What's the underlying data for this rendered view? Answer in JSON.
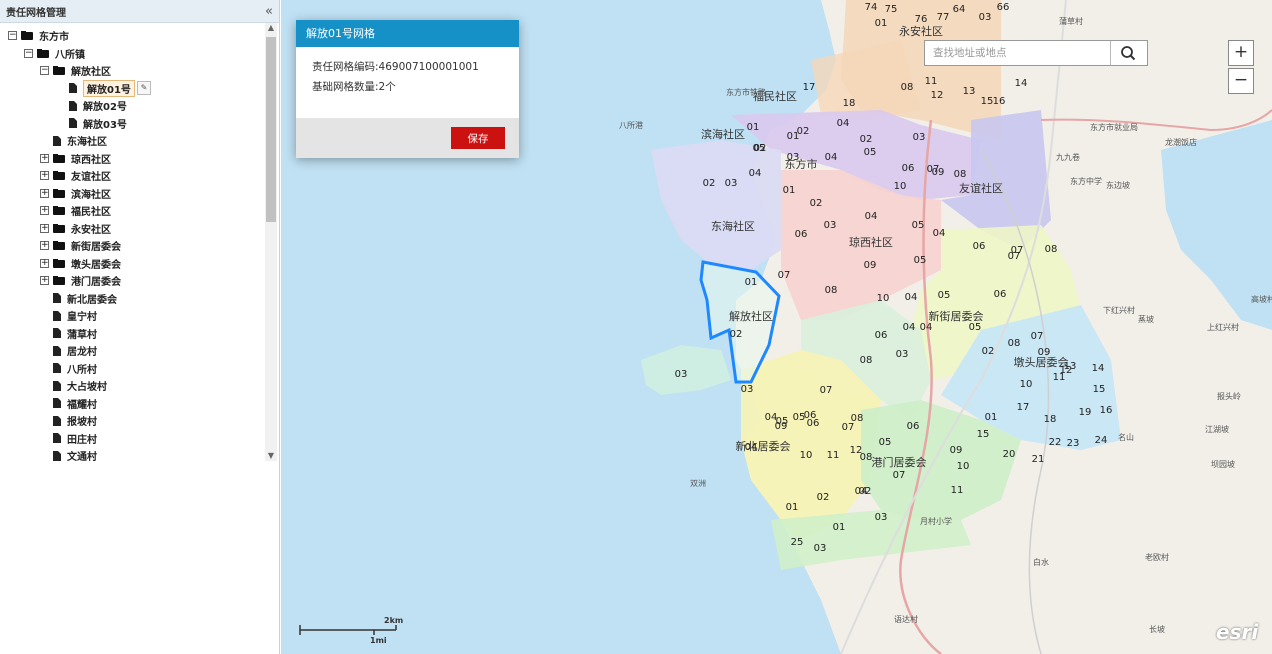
{
  "panel": {
    "title": "责任网格管理",
    "collapse_glyph": "«"
  },
  "tree": [
    {
      "level": 0,
      "toggle": "−",
      "type": "folder",
      "label": "东方市"
    },
    {
      "level": 1,
      "toggle": "−",
      "type": "folder",
      "label": "八所镇"
    },
    {
      "level": 2,
      "toggle": "−",
      "type": "folder",
      "label": "解放社区"
    },
    {
      "level": 3,
      "toggle": "",
      "type": "doc",
      "label": "解放01号",
      "selected": true
    },
    {
      "level": 3,
      "toggle": "",
      "type": "doc",
      "label": "解放02号"
    },
    {
      "level": 3,
      "toggle": "",
      "type": "doc",
      "label": "解放03号"
    },
    {
      "level": 2,
      "toggle": "",
      "type": "doc",
      "label": "东海社区"
    },
    {
      "level": 2,
      "toggle": "+",
      "type": "folder",
      "label": "琼西社区"
    },
    {
      "level": 2,
      "toggle": "+",
      "type": "folder",
      "label": "友谊社区"
    },
    {
      "level": 2,
      "toggle": "+",
      "type": "folder",
      "label": "滨海社区"
    },
    {
      "level": 2,
      "toggle": "+",
      "type": "folder",
      "label": "福民社区"
    },
    {
      "level": 2,
      "toggle": "+",
      "type": "folder",
      "label": "永安社区"
    },
    {
      "level": 2,
      "toggle": "+",
      "type": "folder",
      "label": "新街居委会"
    },
    {
      "level": 2,
      "toggle": "+",
      "type": "folder",
      "label": "墩头居委会"
    },
    {
      "level": 2,
      "toggle": "+",
      "type": "folder",
      "label": "港门居委会"
    },
    {
      "level": 2,
      "toggle": "",
      "type": "doc",
      "label": "新北居委会"
    },
    {
      "level": 2,
      "toggle": "",
      "type": "doc",
      "label": "皇宁村"
    },
    {
      "level": 2,
      "toggle": "",
      "type": "doc",
      "label": "蒲草村"
    },
    {
      "level": 2,
      "toggle": "",
      "type": "doc",
      "label": "居龙村"
    },
    {
      "level": 2,
      "toggle": "",
      "type": "doc",
      "label": "八所村"
    },
    {
      "level": 2,
      "toggle": "",
      "type": "doc",
      "label": "大占坡村"
    },
    {
      "level": 2,
      "toggle": "",
      "type": "doc",
      "label": "福耀村"
    },
    {
      "level": 2,
      "toggle": "",
      "type": "doc",
      "label": "报坡村"
    },
    {
      "level": 2,
      "toggle": "",
      "type": "doc",
      "label": "田庄村"
    },
    {
      "level": 2,
      "toggle": "",
      "type": "doc",
      "label": "文通村"
    }
  ],
  "popup": {
    "title": "解放01号网格",
    "code_line": "责任网格编码:469007100001001",
    "count_line": "基础网格数量:2个",
    "save_label": "保存"
  },
  "search": {
    "placeholder": "查找地址或地点"
  },
  "zoom": {
    "in": "+",
    "out": "−"
  },
  "scale": {
    "top": "2km",
    "bottom": "1mi"
  },
  "attribution": "esri",
  "colors": {
    "sea": "#bfe1f3",
    "land": "#f2efe9",
    "highlight_outline": "#1e88ff",
    "save_button": "#cc1111",
    "popup_header": "#1591c8"
  },
  "map_labels": {
    "communities": [
      "永安社区",
      "福民社区",
      "滨海社区",
      "东方市",
      "友谊社区",
      "东海社区",
      "琼西社区",
      "解放社区",
      "新街居委会",
      "墩头居委会",
      "新北居委会",
      "港门居委会"
    ],
    "places": [
      "蒲草村",
      "东方市铁路",
      "东方市就业局",
      "龙潮饭店",
      "九九卷",
      "东方中学",
      "东边坡",
      "下红兴村",
      "上红兴村",
      "高坡村",
      "蒸坡",
      "报头岭",
      "名山",
      "江湖坡",
      "坝园坡",
      "白水",
      "老欧村",
      "语达村",
      "长坡",
      "月村小学",
      "双洲",
      "八所港"
    ]
  },
  "grid_numbers": [
    "74",
    "75",
    "01",
    "76",
    "77",
    "64",
    "03",
    "66",
    "01",
    "02",
    "05",
    "04",
    "03",
    "02",
    "17",
    "18",
    "08",
    "11",
    "12",
    "13",
    "15",
    "14",
    "16",
    "01",
    "02",
    "03",
    "04",
    "05",
    "06",
    "07",
    "08",
    "09",
    "10",
    "02",
    "03",
    "04",
    "01",
    "02",
    "03",
    "04",
    "05",
    "06",
    "07",
    "08",
    "09",
    "10",
    "04",
    "07",
    "05",
    "06",
    "01",
    "02",
    "03",
    "04",
    "05",
    "06",
    "07",
    "08",
    "06",
    "07",
    "08",
    "05",
    "04",
    "03",
    "04",
    "05",
    "06",
    "07",
    "08",
    "09",
    "10",
    "11",
    "12",
    "13",
    "14",
    "15",
    "16",
    "17",
    "18",
    "19",
    "01",
    "02",
    "03",
    "04",
    "05",
    "06",
    "07",
    "08",
    "09",
    "10",
    "11",
    "12",
    "01",
    "02",
    "03",
    "04",
    "05",
    "06",
    "07",
    "08",
    "09",
    "10",
    "11",
    "15",
    "20",
    "21",
    "22",
    "23",
    "24",
    "25",
    "01",
    "02",
    "03",
    "04"
  ]
}
